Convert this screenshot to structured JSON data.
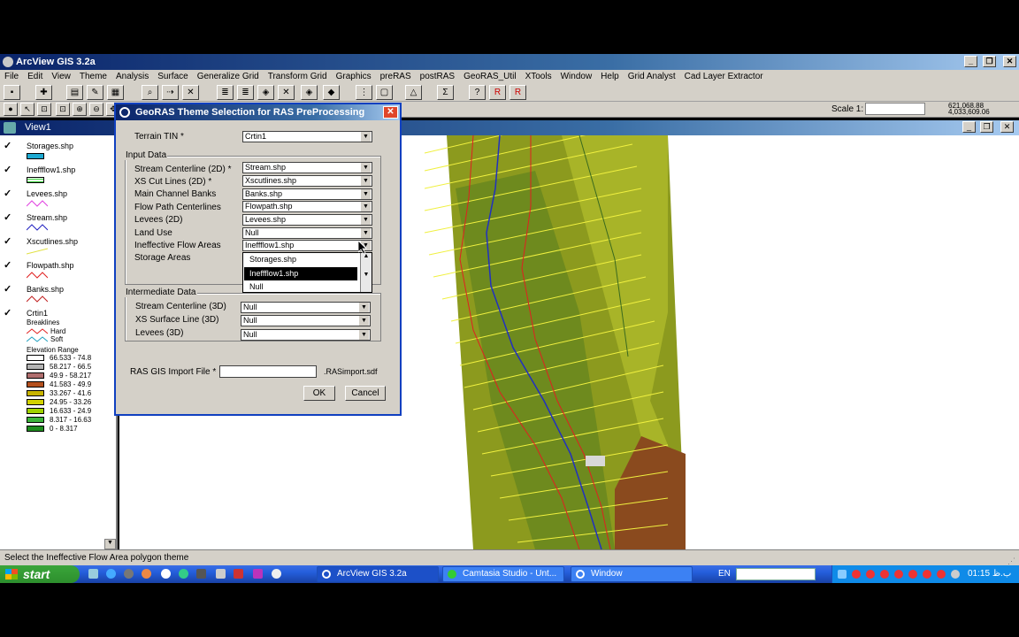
{
  "app": {
    "title": "ArcView GIS 3.2a",
    "menu": [
      "File",
      "Edit",
      "View",
      "Theme",
      "Analysis",
      "Surface",
      "Generalize Grid",
      "Transform Grid",
      "Graphics",
      "preRAS",
      "postRAS",
      "GeoRAS_Util",
      "XTools",
      "Window",
      "Help",
      "Grid Analyst",
      "Cad Layer Extractor"
    ],
    "scale_label": "Scale 1:",
    "coord_x": "621,068.88",
    "coord_y": "4,033,609.06",
    "view_title": "View1",
    "status": "Select the Ineffective Flow Area polygon theme"
  },
  "toc": {
    "themes": [
      {
        "name": "Storages.shp"
      },
      {
        "name": "Ineffflow1.shp"
      },
      {
        "name": "Levees.shp"
      },
      {
        "name": "Stream.shp"
      },
      {
        "name": "Xscutlines.shp"
      },
      {
        "name": "Flowpath.shp"
      },
      {
        "name": "Banks.shp"
      },
      {
        "name": "Crtin1"
      }
    ],
    "breaklines_label": "Breaklines",
    "hard_label": "Hard",
    "soft_label": "Soft",
    "elevation_label": "Elevation Range",
    "ranges": [
      {
        "label": "66.533 - 74.8",
        "color": "#ffffff"
      },
      {
        "label": "58.217 - 66.5",
        "color": "#b4b4b4"
      },
      {
        "label": "49.9 - 58.217",
        "color": "#b06e6e"
      },
      {
        "label": "41.583 - 49.9",
        "color": "#b4501e"
      },
      {
        "label": "33.267 - 41.6",
        "color": "#c8b400"
      },
      {
        "label": "24.95 - 33.26",
        "color": "#d2d200"
      },
      {
        "label": "16.633 - 24.9",
        "color": "#a0d200"
      },
      {
        "label": "8.317 - 16.63",
        "color": "#3cb43c"
      },
      {
        "label": "0 - 8.317",
        "color": "#1e8c1e"
      }
    ]
  },
  "dialog": {
    "title": "GeoRAS Theme Selection for RAS PreProcessing",
    "terrain_label": "Terrain TIN *",
    "terrain_value": "Crtin1",
    "input_group": "Input Data",
    "fields": [
      {
        "label": "Stream Centerline (2D) *",
        "value": "Stream.shp"
      },
      {
        "label": "XS Cut Lines (2D) *",
        "value": "Xscutlines.shp"
      },
      {
        "label": "Main Channel Banks",
        "value": "Banks.shp"
      },
      {
        "label": "Flow Path Centerlines",
        "value": "Flowpath.shp"
      },
      {
        "label": "Levees (2D)",
        "value": "Levees.shp"
      },
      {
        "label": "Land Use",
        "value": "Null"
      },
      {
        "label": "Ineffective Flow Areas",
        "value": "Ineffflow1.shp"
      },
      {
        "label": "Storage Areas",
        "value": ""
      }
    ],
    "dropdown_options": [
      "Storages.shp",
      "Ineffflow1.shp",
      "Null"
    ],
    "intermediate_group": "Intermediate Data",
    "intermediate_fields": [
      {
        "label": "Stream Centerline (3D)",
        "value": "Null"
      },
      {
        "label": "XS Surface Line (3D)",
        "value": "Null"
      },
      {
        "label": "Levees (3D)",
        "value": "Null"
      }
    ],
    "import_label": "RAS GIS Import File *",
    "import_value": "",
    "import_suffix": ".RASimport.sdf",
    "ok_label": "OK",
    "cancel_label": "Cancel"
  },
  "taskbar": {
    "start_label": "start",
    "tasks": [
      "ArcView GIS 3.2a",
      "Camtasia Studio - Unt...",
      "Window"
    ],
    "lang": "EN",
    "clock": "01:15 ب.ظ"
  }
}
